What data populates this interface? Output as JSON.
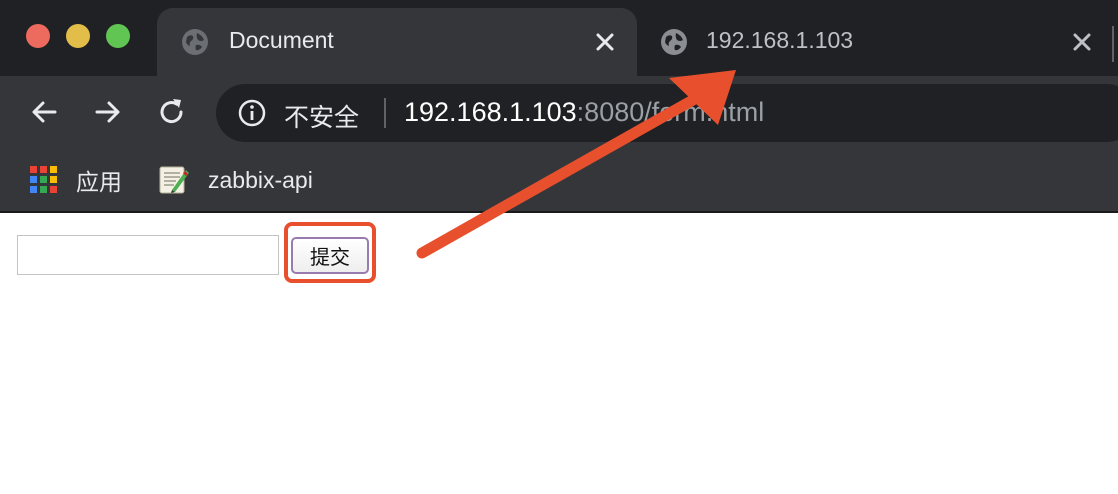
{
  "window": {
    "traffic_lights": {
      "close": "#ec6a5e",
      "minimize": "#e3bd4a",
      "maximize": "#61c554"
    }
  },
  "tabs": [
    {
      "title": "Document",
      "active": true,
      "icon": "globe-icon"
    },
    {
      "title": "192.168.1.103",
      "active": false,
      "icon": "globe-icon"
    }
  ],
  "toolbar": {
    "back_icon": "arrow-left-icon",
    "forward_icon": "arrow-right-icon",
    "reload_icon": "reload-icon",
    "omnibox": {
      "security_label": "不安全",
      "url_host": "192.168.1.103",
      "url_rest": ":8080/form.html"
    }
  },
  "bookmarks": [
    {
      "label": "应用",
      "icon": "apps-grid-icon"
    },
    {
      "label": "zabbix-api",
      "icon": "zabbix-bookmark-icon"
    }
  ],
  "page": {
    "text_input_value": "",
    "submit_label": "提交"
  },
  "annotation": {
    "color": "#e8502d"
  }
}
